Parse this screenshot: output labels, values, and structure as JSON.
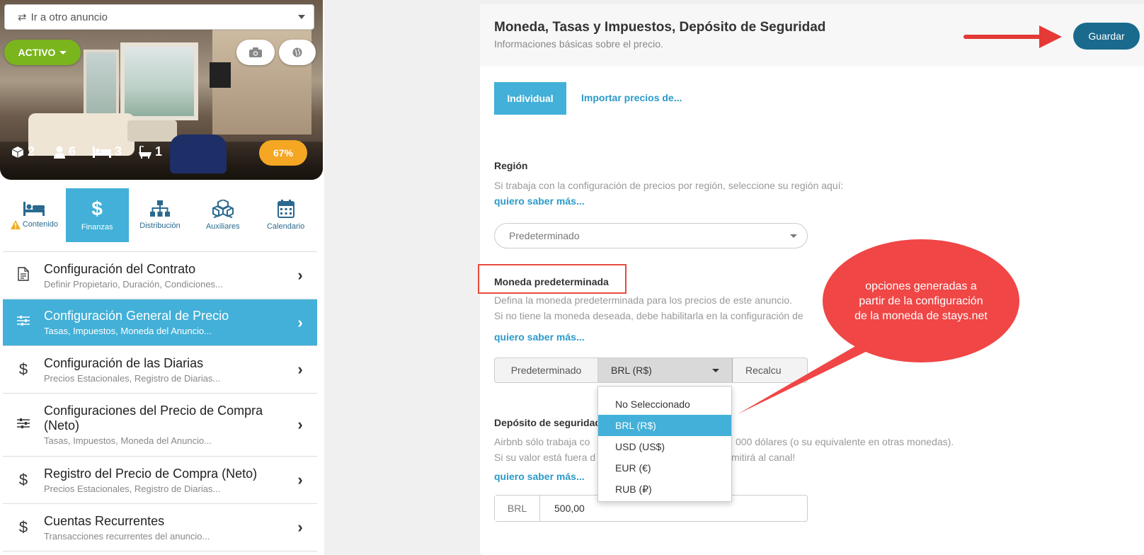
{
  "listing": {
    "selector_label": "Ir a otro anuncio",
    "status_label": "ACTIVO",
    "stats": {
      "rooms": "2",
      "guests": "6",
      "beds": "3",
      "baths": "1"
    },
    "completion": "67%"
  },
  "tabs": [
    {
      "label": "Contenido",
      "icon": "bed-icon",
      "warning": true
    },
    {
      "label": "Finanzas",
      "icon": "dollar-icon",
      "active": true
    },
    {
      "label": "Distribución",
      "icon": "sitemap-icon"
    },
    {
      "label": "Auxiliares",
      "icon": "cubes-icon"
    },
    {
      "label": "Calendario",
      "icon": "calendar-icon"
    }
  ],
  "menu": [
    {
      "title": "Configuración del Contrato",
      "subtitle": "Definir Propietario, Duración, Condiciones...",
      "icon": "document-icon"
    },
    {
      "title": "Configuración General de Precio",
      "subtitle": "Tasas, Impuestos, Moneda del Anuncio...",
      "icon": "sliders-icon",
      "active": true
    },
    {
      "title": "Configuración de las Diarias",
      "subtitle": "Precios Estacionales, Registro de Diarias...",
      "icon": "dollar-icon"
    },
    {
      "title": "Configuraciones del Precio de Compra (Neto)",
      "subtitle": "Tasas, Impuestos, Moneda del Anuncio...",
      "icon": "sliders-icon"
    },
    {
      "title": "Registro del Precio de Compra (Neto)",
      "subtitle": "Precios Estacionales, Registro de Diarias...",
      "icon": "dollar-icon"
    },
    {
      "title": "Cuentas Recurrentes",
      "subtitle": "Transacciones recurrentes del anuncio...",
      "icon": "dollar-icon"
    }
  ],
  "card": {
    "title": "Moneda, Tasas y Impuestos, Depósito de Seguridad",
    "subtitle": "Informaciones básicas sobre el precio.",
    "save_label": "Guardar",
    "mode_active": "Individual",
    "mode_import": "Importar precios de..."
  },
  "region": {
    "title": "Región",
    "text": "Si trabaja con la configuración de precios por región, seleccione su región aquí:",
    "link": "quiero saber más...",
    "selected": "Predeterminado"
  },
  "currency": {
    "title": "Moneda predeterminada",
    "text1": "Defina la moneda predeterminada para los precios de este anuncio.",
    "text2": "Si no tiene la moneda deseada, debe habilitarla en la configuración de",
    "link": "quiero saber más...",
    "segment_default": "Predeterminado",
    "selected": "BRL (R$)",
    "segment_recalc": "Recalcu",
    "options": [
      "No Seleccionado",
      "BRL (R$)",
      "USD (US$)",
      "EUR (€)",
      "RUB (₽)"
    ],
    "selected_index": 1
  },
  "deposit": {
    "title": "Depósito de seguridad",
    "text1_start": "Airbnb sólo trabaja co",
    "text1_end": "000 dólares (o su equivalente en otras monedas).",
    "text2_start": "Si su valor está fuera d",
    "text2_end": "mitirá al canal!",
    "link": "quiero saber más...",
    "currency": "BRL",
    "value": "500,00"
  },
  "callout": {
    "text": "opciones generadas a partir de la configuración de la moneda de stays.net"
  },
  "colors": {
    "accent": "#42b0d8",
    "save": "#1a6a8e",
    "status": "#7ab51d",
    "completion": "#f5a623",
    "annotation": "#e74c3c"
  }
}
